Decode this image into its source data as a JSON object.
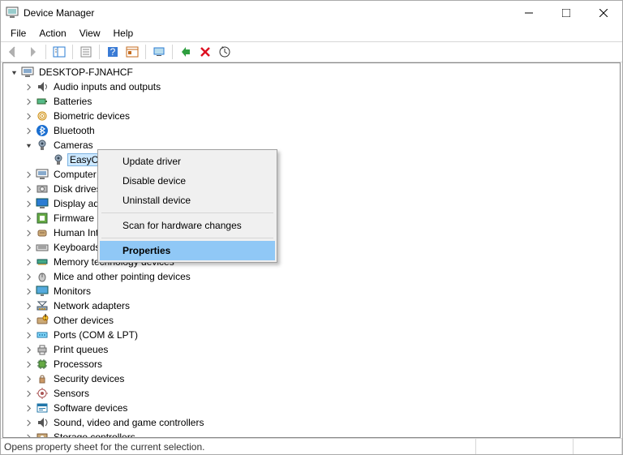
{
  "window": {
    "title": "Device Manager"
  },
  "menubar": {
    "file": "File",
    "action": "Action",
    "view": "View",
    "help": "Help"
  },
  "tree": {
    "root": "DESKTOP-FJNAHCF",
    "selected_device": "EasyCa",
    "items": [
      {
        "label": "Audio inputs and outputs",
        "icon": "audio"
      },
      {
        "label": "Batteries",
        "icon": "battery"
      },
      {
        "label": "Biometric devices",
        "icon": "biometric"
      },
      {
        "label": "Bluetooth",
        "icon": "bluetooth"
      },
      {
        "label": "Cameras",
        "icon": "camera",
        "expanded": true
      },
      {
        "label": "Computer",
        "icon": "computer"
      },
      {
        "label": "Disk drives",
        "icon": "disk"
      },
      {
        "label": "Display ada",
        "icon": "display"
      },
      {
        "label": "Firmware",
        "icon": "firmware"
      },
      {
        "label": "Human Int",
        "icon": "hid"
      },
      {
        "label": "Keyboards",
        "icon": "keyboard"
      },
      {
        "label": "Memory technology devices",
        "icon": "memory"
      },
      {
        "label": "Mice and other pointing devices",
        "icon": "mouse"
      },
      {
        "label": "Monitors",
        "icon": "monitor"
      },
      {
        "label": "Network adapters",
        "icon": "network"
      },
      {
        "label": "Other devices",
        "icon": "other"
      },
      {
        "label": "Ports (COM & LPT)",
        "icon": "port"
      },
      {
        "label": "Print queues",
        "icon": "printer"
      },
      {
        "label": "Processors",
        "icon": "cpu"
      },
      {
        "label": "Security devices",
        "icon": "security"
      },
      {
        "label": "Sensors",
        "icon": "sensor"
      },
      {
        "label": "Software devices",
        "icon": "software"
      },
      {
        "label": "Sound, video and game controllers",
        "icon": "sound"
      },
      {
        "label": "Storage controllers",
        "icon": "storage"
      }
    ]
  },
  "contextmenu": {
    "update": "Update driver",
    "disable": "Disable device",
    "uninstall": "Uninstall device",
    "scan": "Scan for hardware changes",
    "properties": "Properties"
  },
  "statusbar": {
    "msg": "Opens property sheet for the current selection."
  }
}
